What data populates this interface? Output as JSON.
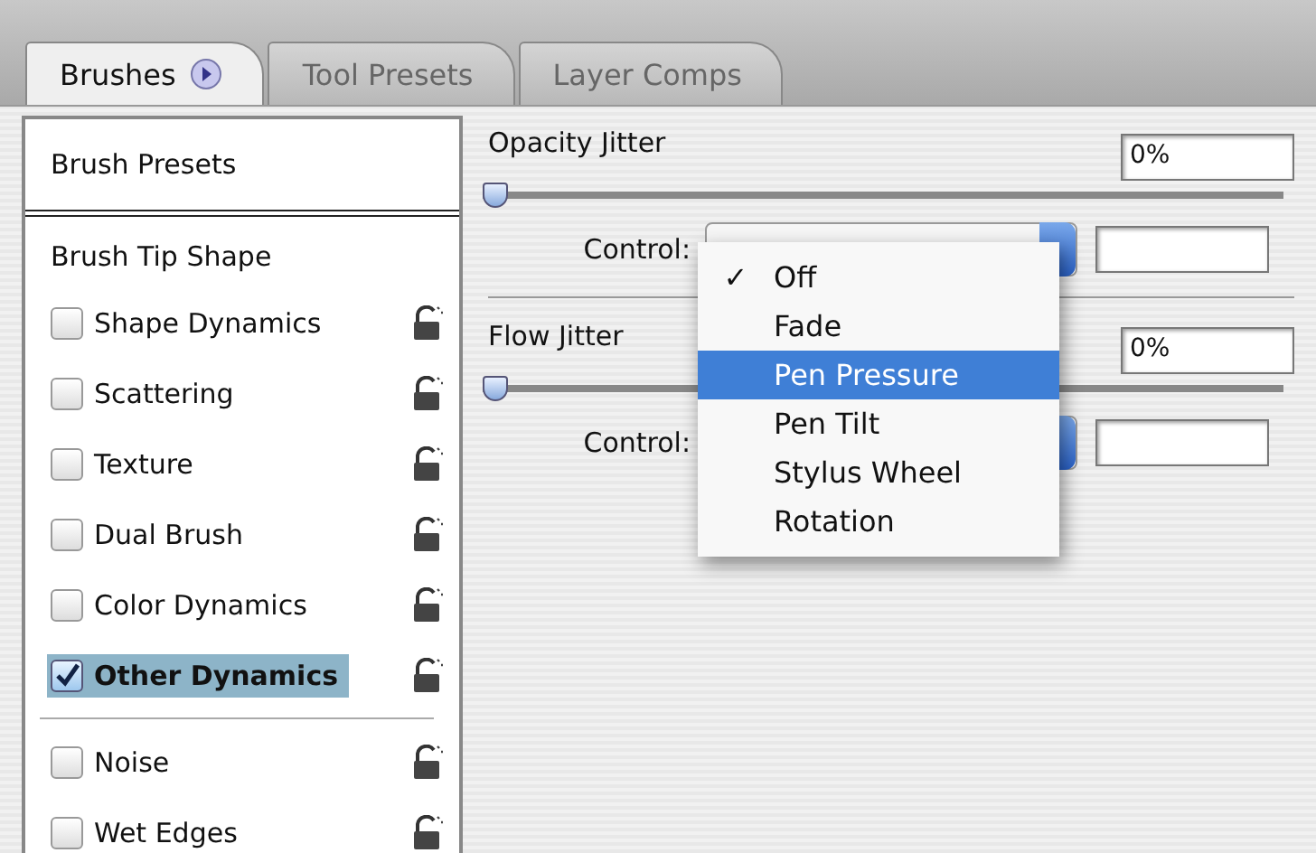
{
  "tabs": [
    {
      "label": "Brushes",
      "selected": true,
      "menu_button": true
    },
    {
      "label": "Tool Presets",
      "selected": false,
      "menu_button": false
    },
    {
      "label": "Layer Comps",
      "selected": false,
      "menu_button": false
    }
  ],
  "sidebar": {
    "items": [
      {
        "kind": "header",
        "label": "Brush Presets",
        "selected": false
      },
      {
        "kind": "section",
        "label": "Brush Tip Shape",
        "selected": false
      },
      {
        "kind": "option",
        "label": "Shape Dynamics",
        "checked": false,
        "selected": false
      },
      {
        "kind": "option",
        "label": "Scattering",
        "checked": false,
        "selected": false
      },
      {
        "kind": "option",
        "label": "Texture",
        "checked": false,
        "selected": false
      },
      {
        "kind": "option",
        "label": "Dual Brush",
        "checked": false,
        "selected": false
      },
      {
        "kind": "option",
        "label": "Color Dynamics",
        "checked": false,
        "selected": false
      },
      {
        "kind": "option",
        "label": "Other Dynamics",
        "checked": true,
        "selected": true
      },
      {
        "kind": "separator"
      },
      {
        "kind": "option",
        "label": "Noise",
        "checked": false,
        "selected": false
      },
      {
        "kind": "option",
        "label": "Wet Edges",
        "checked": false,
        "selected": false
      }
    ]
  },
  "settings": [
    {
      "label": "Opacity Jitter",
      "value": "0%",
      "level": 0,
      "control": {
        "label": "Control:"
      }
    },
    {
      "label": "Flow Jitter",
      "value": "0%",
      "level": 0,
      "control": {
        "label": "Control:"
      }
    }
  ],
  "menu": {
    "items": [
      {
        "label": "Off",
        "checked": true,
        "highlighted": false
      },
      {
        "label": "Fade",
        "checked": false,
        "highlighted": false
      },
      {
        "label": "Pen Pressure",
        "checked": false,
        "highlighted": true
      },
      {
        "label": "Pen Tilt",
        "checked": false,
        "highlighted": false
      },
      {
        "label": "Stylus Wheel",
        "checked": false,
        "highlighted": false
      },
      {
        "label": "Rotation",
        "checked": false,
        "highlighted": false
      }
    ],
    "check_glyph": "✓"
  }
}
